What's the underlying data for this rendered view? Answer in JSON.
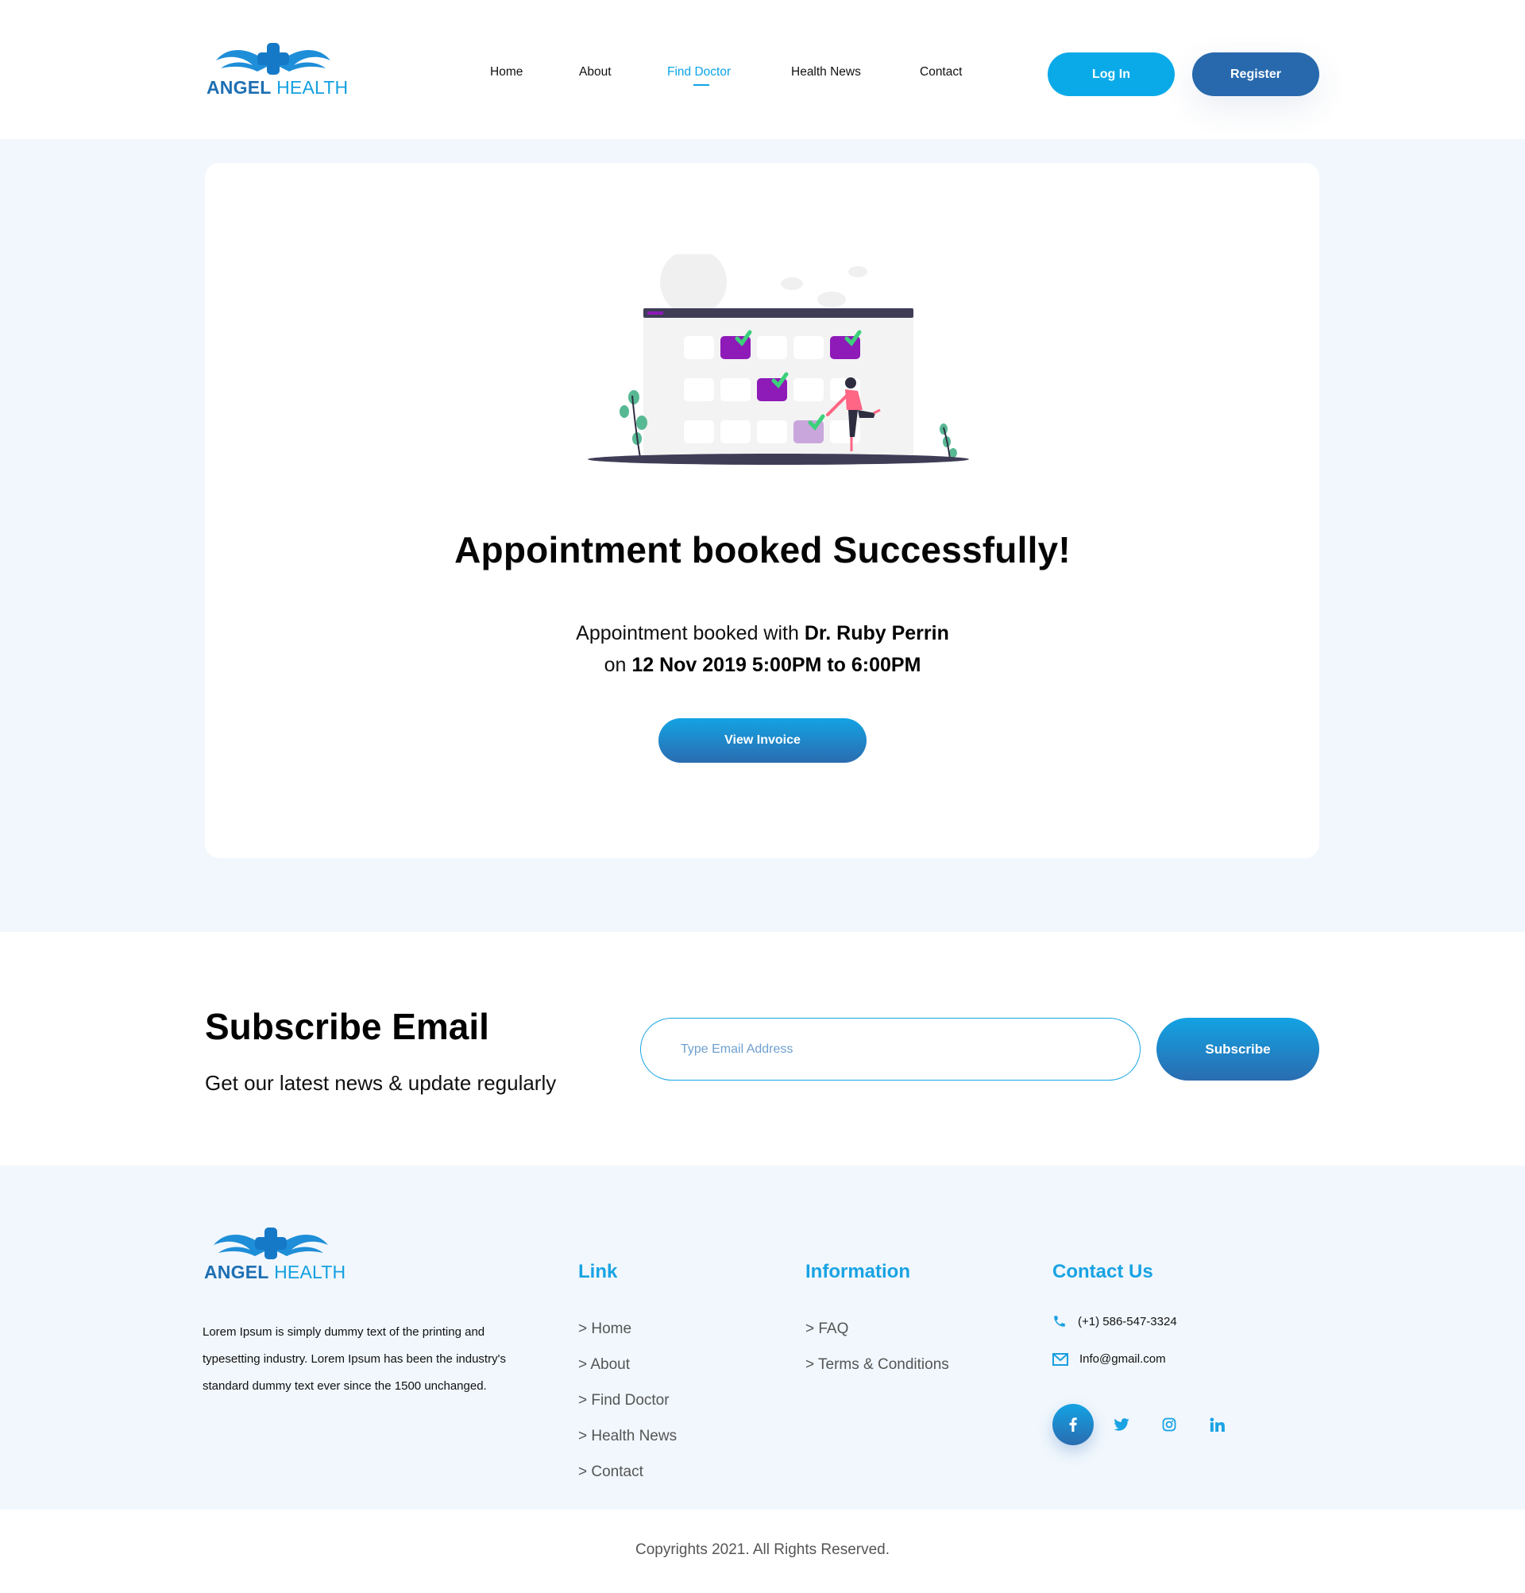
{
  "brand": {
    "name_part1": "ANGEL",
    "name_part2": "HEALTH"
  },
  "nav": {
    "items": [
      {
        "label": "Home"
      },
      {
        "label": "About"
      },
      {
        "label": "Find Doctor",
        "active": true
      },
      {
        "label": "Health News"
      },
      {
        "label": "Contact"
      }
    ],
    "login_label": "Log In",
    "register_label": "Register"
  },
  "confirmation": {
    "headline": "Appointment booked Successfully!",
    "line1_prefix": "Appointment booked with",
    "doctor": "Dr. Ruby Perrin",
    "line2_prefix": "on",
    "datetime": "12 Nov 2019 5:00PM to 6:00PM",
    "invoice_button": "View Invoice"
  },
  "subscribe": {
    "title": "Subscribe Email",
    "subtitle": "Get our latest news & update regularly",
    "placeholder": "Type Email Address",
    "button": "Subscribe"
  },
  "footer": {
    "about": "Lorem Ipsum is simply dummy text of the printing and typesetting industry. Lorem Ipsum has been the industry's standard dummy text ever since the 1500 unchanged.",
    "link_title": "Link",
    "links": [
      "> Home",
      "> About",
      "> Find Doctor",
      "> Health News",
      "> Contact"
    ],
    "info_title": "Information",
    "info_links": [
      "> FAQ",
      "> Terms & Conditions"
    ],
    "contact_title": "Contact Us",
    "phone": "(+1) 586-547-3324",
    "email": "Info@gmail.com",
    "social": [
      "facebook-icon",
      "twitter-icon",
      "instagram-icon",
      "linkedin-icon"
    ],
    "copyright": "Copyrights 2021. All Rights Reserved."
  },
  "colors": {
    "accent": "#0aaae9",
    "brand_dark": "#2869ad",
    "section_bg": "#f1f7fd",
    "calendar_purple": "#8e1ab8",
    "check_green": "#3bd17a"
  }
}
